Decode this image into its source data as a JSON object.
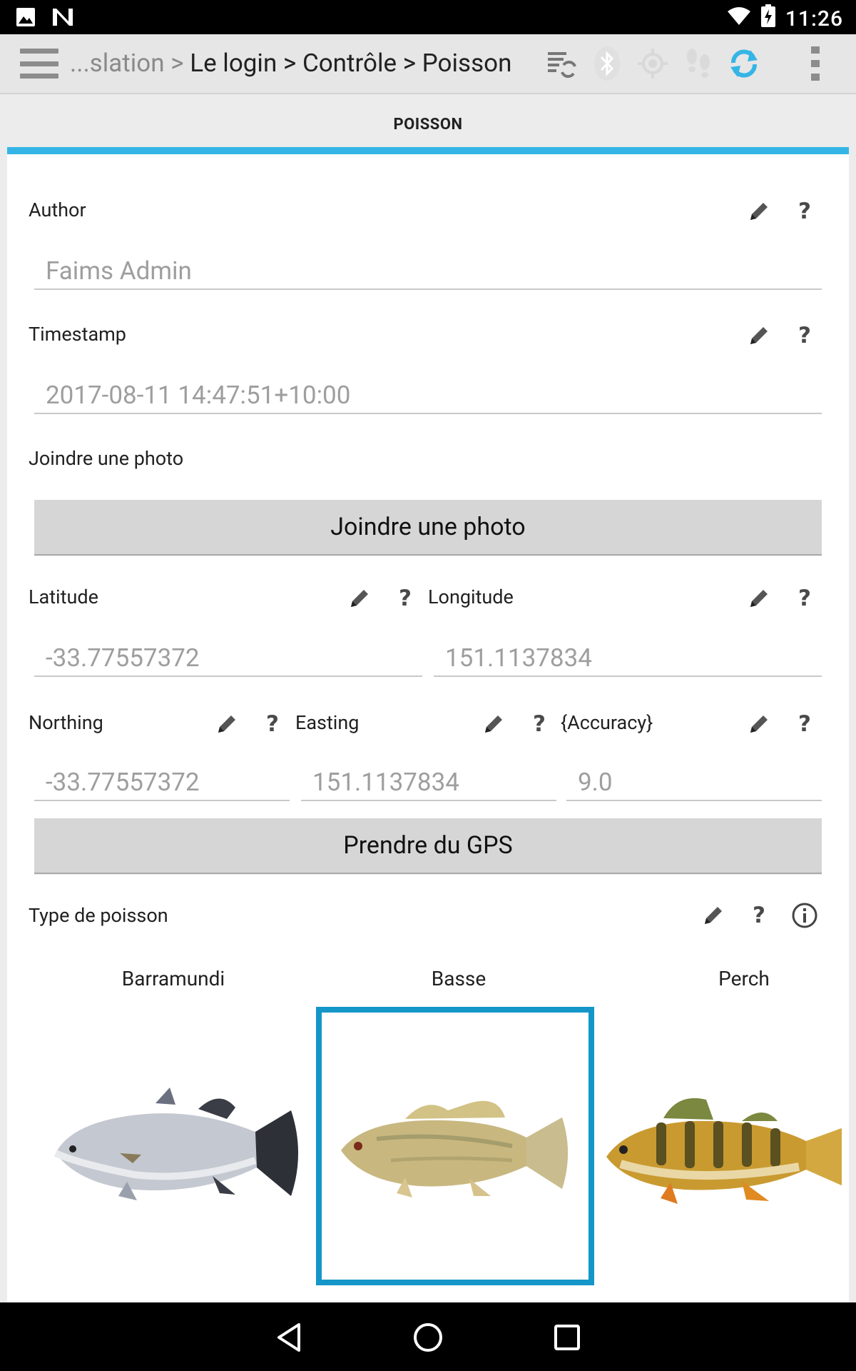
{
  "status_bar": {
    "time": "11:26",
    "icons": [
      "image-icon",
      "n-icon",
      "wifi-icon",
      "battery-charging-icon"
    ]
  },
  "action_bar": {
    "breadcrumb_prefix": "...slation > ",
    "breadcrumb_rest": "Le login > Contrôle > Poisson",
    "icons": [
      "sync-settings-icon",
      "bluetooth-icon",
      "gps-icon",
      "tracking-icon",
      "sync-icon",
      "overflow-menu-icon"
    ],
    "accent": "#35b5e5"
  },
  "tab": {
    "label": "POISSON"
  },
  "fields": {
    "author": {
      "label": "Author",
      "value": "Faims Admin"
    },
    "timestamp": {
      "label": "Timestamp",
      "value": "2017-08-11 14:47:51+10:00"
    },
    "photo": {
      "label": "Joindre une photo",
      "button": "Joindre une photo"
    },
    "latitude": {
      "label": "Latitude",
      "value": "-33.77557372"
    },
    "longitude": {
      "label": "Longitude",
      "value": "151.1137834"
    },
    "northing": {
      "label": "Northing",
      "value": "-33.77557372"
    },
    "easting": {
      "label": "Easting",
      "value": "151.1137834"
    },
    "accuracy": {
      "label": "{Accuracy}",
      "value": "9.0"
    },
    "gps_button": "Prendre du GPS",
    "fish_type": {
      "label": "Type de poisson",
      "options": [
        "Barramundi",
        "Basse",
        "Perch"
      ],
      "selected": "Basse",
      "selected_color": "#1596c8"
    }
  },
  "help_glyph": "?"
}
